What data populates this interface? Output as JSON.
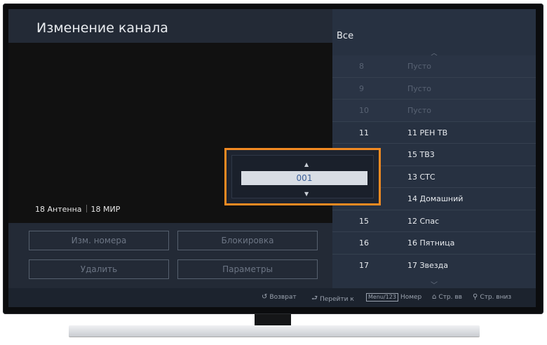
{
  "screen_title": "Изменение канала",
  "source": {
    "input": "18 Антенна",
    "channel": "18 МИР"
  },
  "buttons": {
    "change_number": "Изм. номера",
    "lock": "Блокировка",
    "delete": "Удалить",
    "parameters": "Параметры"
  },
  "list": {
    "label": "Все",
    "rows": [
      {
        "num": "8",
        "name": "Пусто",
        "state": "dim"
      },
      {
        "num": "9",
        "name": "Пусто",
        "state": "dim"
      },
      {
        "num": "10",
        "name": "Пусто",
        "state": "dim"
      },
      {
        "num": "11",
        "name": "11 РЕН ТВ",
        "state": "bright"
      },
      {
        "num": "",
        "name": "15 ТВ3",
        "state": "bright"
      },
      {
        "num": "",
        "name": "13 СТС",
        "state": "bright"
      },
      {
        "num": "14",
        "name": "14 Домашний",
        "state": "bright"
      },
      {
        "num": "15",
        "name": "12 Спас",
        "state": "bright"
      },
      {
        "num": "16",
        "name": "16 Пятница",
        "state": "bright"
      },
      {
        "num": "17",
        "name": "17 Звезда",
        "state": "bright"
      }
    ]
  },
  "edit_popup": {
    "value": "001"
  },
  "hints": {
    "back": "Возврат",
    "goto": "Перейти к",
    "menu_key": "Menu/123",
    "number": "Номер",
    "page_up": "Стр. вв",
    "page_down": "Стр. вниз"
  },
  "colors": {
    "popup_border": "#f28a22",
    "screen_bg": "#232a36"
  }
}
